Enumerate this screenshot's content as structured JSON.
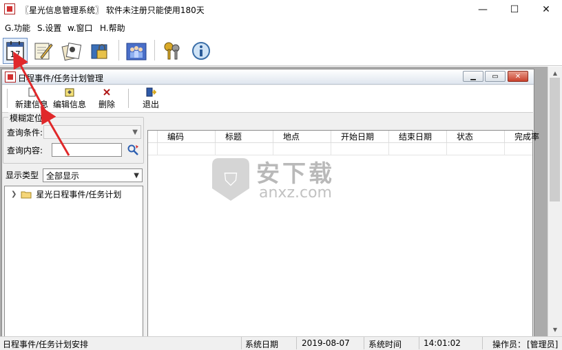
{
  "window": {
    "title": "〖星光信息管理系统〗 软件未注册只能使用180天",
    "min_glyph": "—",
    "max_glyph": "☐",
    "close_glyph": "✕"
  },
  "menu": {
    "items": [
      "G.功能",
      "S.设置",
      "w.窗口",
      "H.帮助"
    ]
  },
  "toolbar": {
    "calendar_day": "17"
  },
  "child": {
    "title": "日程事件/任务计划管理",
    "buttons": {
      "new": "新建信息",
      "edit": "编辑信息",
      "delete": "删除",
      "exit": "退出"
    }
  },
  "search": {
    "group_title": "模糊定位",
    "condition_label": "查询条件:",
    "condition_value": "",
    "content_label": "查询内容:",
    "content_value": ""
  },
  "display": {
    "label": "显示类型",
    "value": "全部显示"
  },
  "tree": {
    "root": "星光日程事件/任务计划"
  },
  "grid": {
    "columns": [
      "编码",
      "标题",
      "地点",
      "开始日期",
      "结束日期",
      "状态",
      "完成率"
    ]
  },
  "watermark": {
    "title": "安下载",
    "subtitle": "anxz.com"
  },
  "status": {
    "module": "日程事件/任务计划安排",
    "date_label": "系统日期",
    "date_value": "2019-08-07",
    "time_label": "系统时间",
    "time_value": "14:01:02",
    "operator_label": "操作员：",
    "operator_value": "[管理员]"
  },
  "colors": {
    "arrow": "#e0282a",
    "accent": "#6a8ec2"
  }
}
